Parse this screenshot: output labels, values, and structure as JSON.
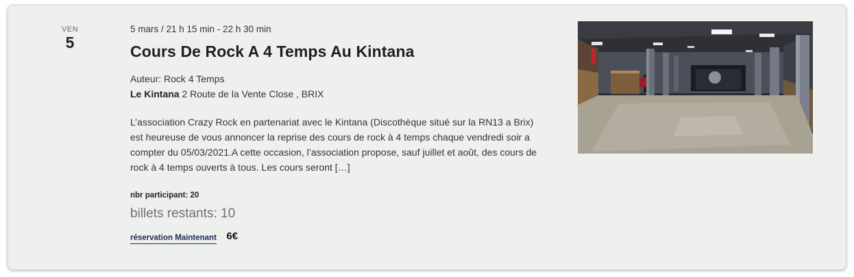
{
  "event": {
    "date": {
      "weekday": "VEN",
      "day": "5"
    },
    "time_range": "5 mars / 21 h 15 min - 22 h 30 min",
    "title": "Cours De Rock A 4 Temps Au Kintana",
    "author": "Auteur: Rock 4 Temps",
    "venue": {
      "name": "Le Kintana",
      "address": "2 Route de la Vente Close , BRIX"
    },
    "description": "L’association Crazy Rock en partenariat avec le Kintana (Discothèque situé sur la RN13 a Brix) est heureuse de vous annoncer la reprise des cours de rock à 4 temps chaque vendredi soir a compter du 05/03/2021.A cette occasion, l’association propose, sauf juillet et août, des cours de rock à 4 temps ouverts à tous. Les cours seront […]",
    "participants": "nbr participant: 20",
    "tickets_remaining": "billets restants: 10",
    "reserve_label": "réservation Maintenant",
    "price": "6€",
    "image_icon": "venue-photo"
  },
  "colors": {
    "card_bg": "#eef0ee",
    "link": "#1e2a55",
    "muted": "#6f6f6f"
  }
}
